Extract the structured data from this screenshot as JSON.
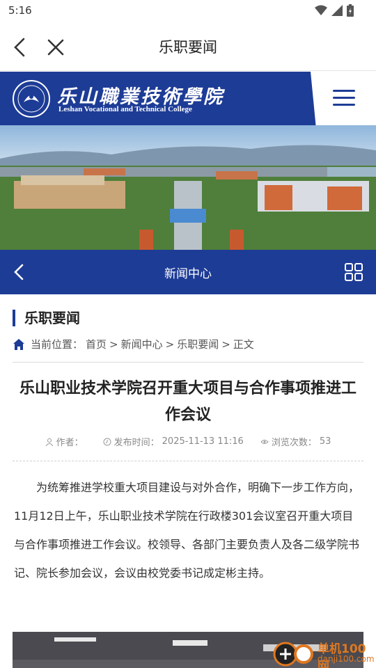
{
  "status_bar": {
    "time": "5:16"
  },
  "app_bar": {
    "title": "乐职要闻"
  },
  "header": {
    "college_name_cn": "乐山職業技術學院",
    "college_name_en": "Leshan Vocational and Technical College"
  },
  "section_nav": {
    "title": "新闻中心"
  },
  "content": {
    "section_title": "乐职要闻",
    "breadcrumb": {
      "label": "当前位置：",
      "items": [
        "首页",
        "新闻中心",
        "乐职要闻",
        "正文"
      ],
      "separator": ">"
    },
    "article": {
      "title": "乐山职业技术学院召开重大项目与合作事项推进工作会议",
      "author_label": "作者：",
      "author": "",
      "date_label": "发布时间：",
      "date": "2025-11-13 11:16",
      "views_label": "浏览次数：",
      "views": "53",
      "body": "为统筹推进学校重大项目建设与对外合作，明确下一步工作方向，11月12日上午，乐山职业技术学院在行政楼301会议室召开重大项目与合作事项推进工作会议。校领导、各部门主要负责人及各二级学院书记、院长参加会议，会议由校党委书记成定彬主持。"
    }
  },
  "watermark": {
    "cn": "单机100网",
    "en": "danji100.com"
  },
  "colors": {
    "brand_blue": "#1d3c96",
    "accent_orange": "#e07820"
  }
}
